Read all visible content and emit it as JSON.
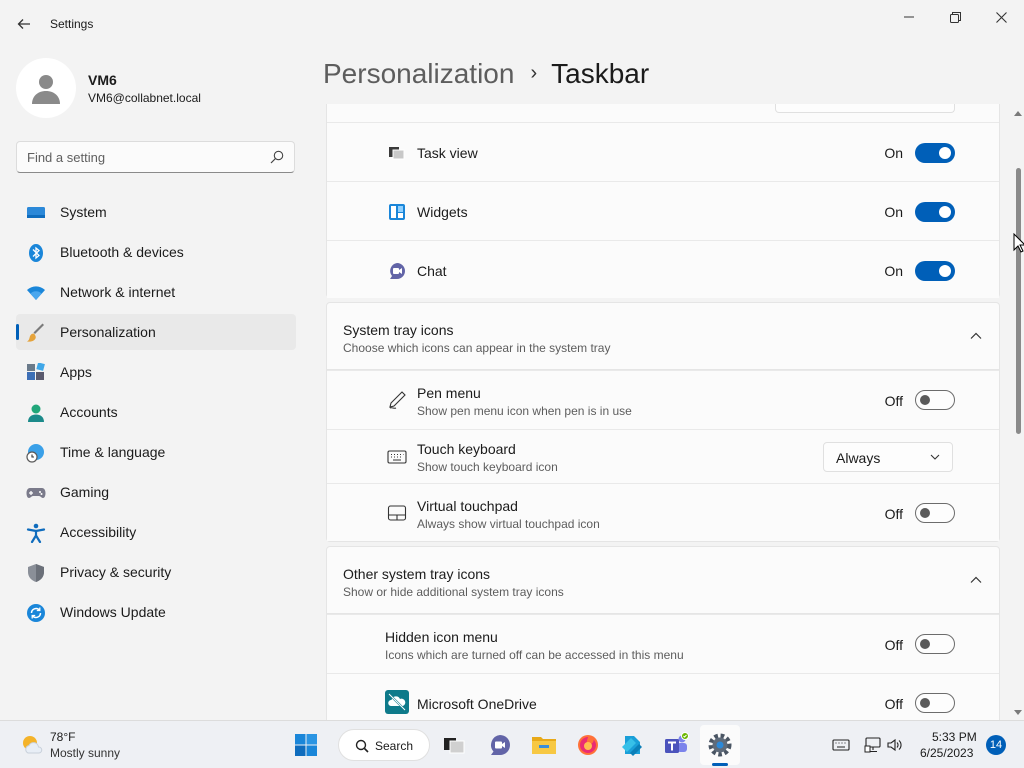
{
  "window": {
    "title": "Settings",
    "back_icon": "back-arrow-icon",
    "controls": [
      "minimize-icon",
      "maximize-icon",
      "close-icon"
    ]
  },
  "profile": {
    "name": "VM6",
    "email": "VM6@collabnet.local"
  },
  "search": {
    "placeholder": "Find a setting",
    "value": ""
  },
  "sidebar": {
    "items": [
      {
        "label": "System",
        "icon": "system-icon",
        "active": false
      },
      {
        "label": "Bluetooth & devices",
        "icon": "bluetooth-icon",
        "active": false
      },
      {
        "label": "Network & internet",
        "icon": "wifi-icon",
        "active": false
      },
      {
        "label": "Personalization",
        "icon": "brush-icon",
        "active": true
      },
      {
        "label": "Apps",
        "icon": "apps-icon",
        "active": false
      },
      {
        "label": "Accounts",
        "icon": "accounts-icon",
        "active": false
      },
      {
        "label": "Time & language",
        "icon": "globe-clock-icon",
        "active": false
      },
      {
        "label": "Gaming",
        "icon": "gamepad-icon",
        "active": false
      },
      {
        "label": "Accessibility",
        "icon": "accessibility-icon",
        "active": false
      },
      {
        "label": "Privacy & security",
        "icon": "shield-icon",
        "active": false
      },
      {
        "label": "Windows Update",
        "icon": "update-icon",
        "active": false
      }
    ]
  },
  "header": {
    "parent": "Personalization",
    "separator": "›",
    "current": "Taskbar"
  },
  "taskbar_items": [
    {
      "label": "Task view",
      "state": "On",
      "on": true,
      "icon": "task-view-icon"
    },
    {
      "label": "Widgets",
      "state": "On",
      "on": true,
      "icon": "widgets-icon"
    },
    {
      "label": "Chat",
      "state": "On",
      "on": true,
      "icon": "chat-icon"
    }
  ],
  "system_tray": {
    "title": "System tray icons",
    "description": "Choose which icons can appear in the system tray",
    "items": [
      {
        "label": "Pen menu",
        "description": "Show pen menu icon when pen is in use",
        "state": "Off",
        "icon": "pen-icon"
      },
      {
        "label": "Touch keyboard",
        "description": "Show touch keyboard icon",
        "dropdown": "Always",
        "icon": "keyboard-icon"
      },
      {
        "label": "Virtual touchpad",
        "description": "Always show virtual touchpad icon",
        "state": "Off",
        "icon": "touchpad-icon"
      }
    ]
  },
  "other_tray": {
    "title": "Other system tray icons",
    "description": "Show or hide additional system tray icons",
    "items": [
      {
        "label": "Hidden icon menu",
        "description": "Icons which are turned off can be accessed in this menu",
        "state": "Off"
      },
      {
        "label": "Microsoft OneDrive",
        "state": "Off",
        "icon": "onedrive-icon"
      }
    ]
  },
  "taskbar": {
    "weather_temp": "78°F",
    "weather_condition": "Mostly sunny",
    "search_label": "Search",
    "clock_time": "5:33 PM",
    "clock_date": "6/25/2023",
    "notification_count": "14",
    "apps": [
      "start-icon",
      "search-icon",
      "task-view-icon",
      "teams-chat-icon",
      "file-explorer-icon",
      "firefox-icon",
      "azure-data-studio-icon",
      "teams-icon",
      "settings-icon"
    ],
    "tray": [
      "keyboard-icon",
      "network-icon",
      "volume-icon"
    ]
  },
  "colors": {
    "accent": "#005fb8",
    "background": "#f3f3f3",
    "card": "#fbfbfb"
  }
}
